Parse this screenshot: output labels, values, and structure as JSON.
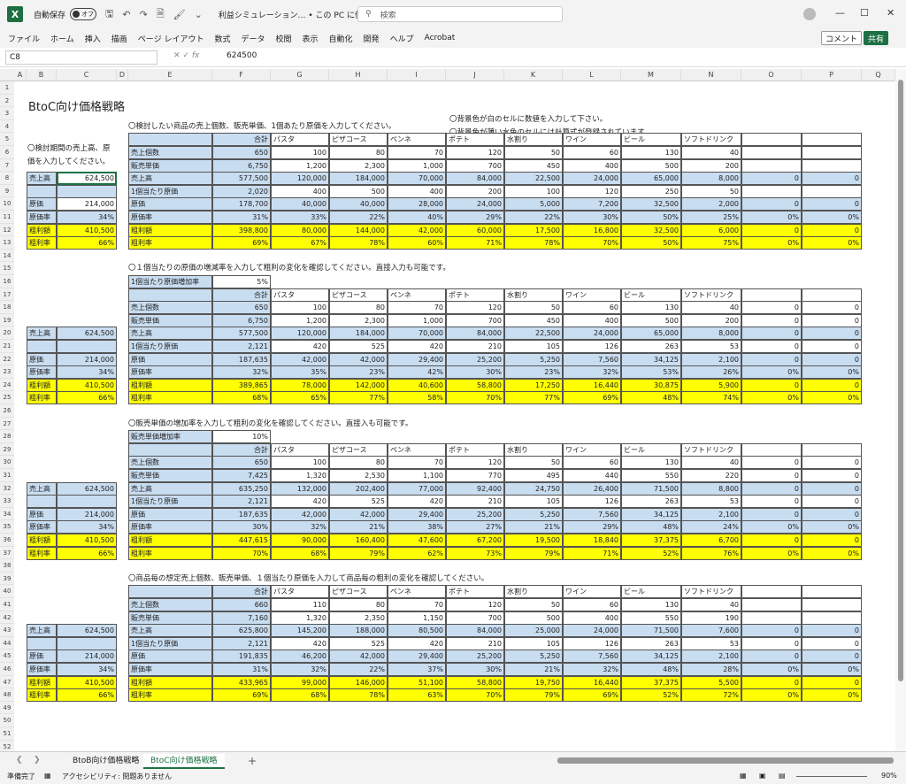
{
  "titlebar": {
    "autosave_label": "自動保存",
    "autosave_state": "オフ",
    "doc_title": "利益シミュレーション… • この PC に保存済み ∨",
    "search_placeholder": "検索"
  },
  "ribbon": {
    "tabs": [
      "ファイル",
      "ホーム",
      "挿入",
      "描画",
      "ページ レイアウト",
      "数式",
      "データ",
      "校閲",
      "表示",
      "自動化",
      "開発",
      "ヘルプ",
      "Acrobat"
    ],
    "comment_label": "コメント",
    "share_label": "共有"
  },
  "formula_bar": {
    "name_box": "C8",
    "formula": "624500"
  },
  "column_headers": [
    "A",
    "B",
    "C",
    "D",
    "E",
    "F",
    "G",
    "H",
    "I",
    "J",
    "K",
    "L",
    "M",
    "N",
    "O",
    "P",
    "Q"
  ],
  "sheet": {
    "title": "BtoC向け価格戦略",
    "note_left": "〇検討期間の売上高、原",
    "note_left2": "価を入力してください。",
    "note_right1": "〇背景色が白のセルに数値を入力して下さい。",
    "note_right2": "〇背景色が薄い水色のセルには計算式が登録されています。",
    "product_headers": [
      "合計",
      "パスタ",
      "ピザコース",
      "ペンネ",
      "ポテト",
      "水割り",
      "ワイン",
      "ビール",
      "ソフトドリンク"
    ],
    "left_labels": [
      "売上高",
      "",
      "原価",
      "原価率",
      "粗利額",
      "粗利率"
    ],
    "row_labels": [
      "売上個数",
      "販売単価",
      "売上高",
      "1個当たり原価",
      "原価",
      "原価率",
      "粗利額",
      "粗利率"
    ],
    "sections": [
      {
        "heading": "〇検討したい商品の売上個数、販売単価、1個あたり原価を入力してください。",
        "left_values": [
          "624,500",
          "",
          "214,000",
          "34%",
          "410,500",
          "66%"
        ],
        "rows": [
          [
            "650",
            "100",
            "80",
            "70",
            "120",
            "50",
            "60",
            "130",
            "40",
            "",
            ""
          ],
          [
            "6,750",
            "1,200",
            "2,300",
            "1,000",
            "700",
            "450",
            "400",
            "500",
            "200",
            "",
            ""
          ],
          [
            "577,500",
            "120,000",
            "184,000",
            "70,000",
            "84,000",
            "22,500",
            "24,000",
            "65,000",
            "8,000",
            "0",
            "0"
          ],
          [
            "2,020",
            "400",
            "500",
            "400",
            "200",
            "100",
            "120",
            "250",
            "50",
            "",
            ""
          ],
          [
            "178,700",
            "40,000",
            "40,000",
            "28,000",
            "24,000",
            "5,000",
            "7,200",
            "32,500",
            "2,000",
            "0",
            "0"
          ],
          [
            "31%",
            "33%",
            "22%",
            "40%",
            "29%",
            "22%",
            "30%",
            "50%",
            "25%",
            "0%",
            "0%"
          ],
          [
            "398,800",
            "80,000",
            "144,000",
            "42,000",
            "60,000",
            "17,500",
            "16,800",
            "32,500",
            "6,000",
            "0",
            "0"
          ],
          [
            "69%",
            "67%",
            "78%",
            "60%",
            "71%",
            "78%",
            "70%",
            "50%",
            "75%",
            "0%",
            "0%"
          ]
        ]
      },
      {
        "heading": "〇１個当たりの原価の増減率を入力して粗利の変化を確認してください。直接入力も可能です。",
        "param_label": "1個当たり原価増加率",
        "param_value": "5%",
        "left_values": [
          "624,500",
          "",
          "214,000",
          "34%",
          "410,500",
          "66%"
        ],
        "rows": [
          [
            "650",
            "100",
            "80",
            "70",
            "120",
            "50",
            "60",
            "130",
            "40",
            "0",
            "0"
          ],
          [
            "6,750",
            "1,200",
            "2,300",
            "1,000",
            "700",
            "450",
            "400",
            "500",
            "200",
            "0",
            "0"
          ],
          [
            "577,500",
            "120,000",
            "184,000",
            "70,000",
            "84,000",
            "22,500",
            "24,000",
            "65,000",
            "8,000",
            "0",
            "0"
          ],
          [
            "2,121",
            "420",
            "525",
            "420",
            "210",
            "105",
            "126",
            "263",
            "53",
            "0",
            "0"
          ],
          [
            "187,635",
            "42,000",
            "42,000",
            "29,400",
            "25,200",
            "5,250",
            "7,560",
            "34,125",
            "2,100",
            "0",
            "0"
          ],
          [
            "32%",
            "35%",
            "23%",
            "42%",
            "30%",
            "23%",
            "32%",
            "53%",
            "26%",
            "0%",
            "0%"
          ],
          [
            "389,865",
            "78,000",
            "142,000",
            "40,600",
            "58,800",
            "17,250",
            "16,440",
            "30,875",
            "5,900",
            "0",
            "0"
          ],
          [
            "68%",
            "65%",
            "77%",
            "58%",
            "70%",
            "77%",
            "69%",
            "48%",
            "74%",
            "0%",
            "0%"
          ]
        ]
      },
      {
        "heading": "〇販売単価の増加率を入力して粗利の変化を確認してください。直接入も可能です。",
        "param_label": "販売単価増加率",
        "param_value": "10%",
        "left_values": [
          "624,500",
          "",
          "214,000",
          "34%",
          "410,500",
          "66%"
        ],
        "rows": [
          [
            "650",
            "100",
            "80",
            "70",
            "120",
            "50",
            "60",
            "130",
            "40",
            "0",
            "0"
          ],
          [
            "7,425",
            "1,320",
            "2,530",
            "1,100",
            "770",
            "495",
            "440",
            "550",
            "220",
            "0",
            "0"
          ],
          [
            "635,250",
            "132,000",
            "202,400",
            "77,000",
            "92,400",
            "24,750",
            "26,400",
            "71,500",
            "8,800",
            "0",
            "0"
          ],
          [
            "2,121",
            "420",
            "525",
            "420",
            "210",
            "105",
            "126",
            "263",
            "53",
            "0",
            "0"
          ],
          [
            "187,635",
            "42,000",
            "42,000",
            "29,400",
            "25,200",
            "5,250",
            "7,560",
            "34,125",
            "2,100",
            "0",
            "0"
          ],
          [
            "30%",
            "32%",
            "21%",
            "38%",
            "27%",
            "21%",
            "29%",
            "48%",
            "24%",
            "0%",
            "0%"
          ],
          [
            "447,615",
            "90,000",
            "160,400",
            "47,600",
            "67,200",
            "19,500",
            "18,840",
            "37,375",
            "6,700",
            "0",
            "0"
          ],
          [
            "70%",
            "68%",
            "79%",
            "62%",
            "73%",
            "79%",
            "71%",
            "52%",
            "76%",
            "0%",
            "0%"
          ]
        ]
      },
      {
        "heading": "〇商品毎の想定売上個数、販売単価、１個当たり原価を入力して商品毎の粗利の変化を確認してください。",
        "left_values": [
          "624,500",
          "",
          "214,000",
          "34%",
          "410,500",
          "66%"
        ],
        "rows": [
          [
            "660",
            "110",
            "80",
            "70",
            "120",
            "50",
            "60",
            "130",
            "40",
            "",
            ""
          ],
          [
            "7,160",
            "1,320",
            "2,350",
            "1,150",
            "700",
            "500",
            "400",
            "550",
            "190",
            "",
            ""
          ],
          [
            "625,800",
            "145,200",
            "188,000",
            "80,500",
            "84,000",
            "25,000",
            "24,000",
            "71,500",
            "7,600",
            "0",
            "0"
          ],
          [
            "2,121",
            "420",
            "525",
            "420",
            "210",
            "105",
            "126",
            "263",
            "53",
            "0",
            "0"
          ],
          [
            "191,835",
            "46,200",
            "42,000",
            "29,400",
            "25,200",
            "5,250",
            "7,560",
            "34,125",
            "2,100",
            "0",
            "0"
          ],
          [
            "31%",
            "32%",
            "22%",
            "37%",
            "30%",
            "21%",
            "32%",
            "48%",
            "28%",
            "0%",
            "0%"
          ],
          [
            "433,965",
            "99,000",
            "146,000",
            "51,100",
            "58,800",
            "19,750",
            "16,440",
            "37,375",
            "5,500",
            "0",
            "0"
          ],
          [
            "69%",
            "68%",
            "78%",
            "63%",
            "70%",
            "79%",
            "69%",
            "52%",
            "72%",
            "0%",
            "0%"
          ]
        ]
      }
    ]
  },
  "sheet_tabs": [
    "BtoB向け価格戦略",
    "BtoC向け価格戦略"
  ],
  "status": {
    "ready": "準備完了",
    "accessibility": "アクセシビリティ: 問題ありません",
    "zoom": "90%"
  }
}
